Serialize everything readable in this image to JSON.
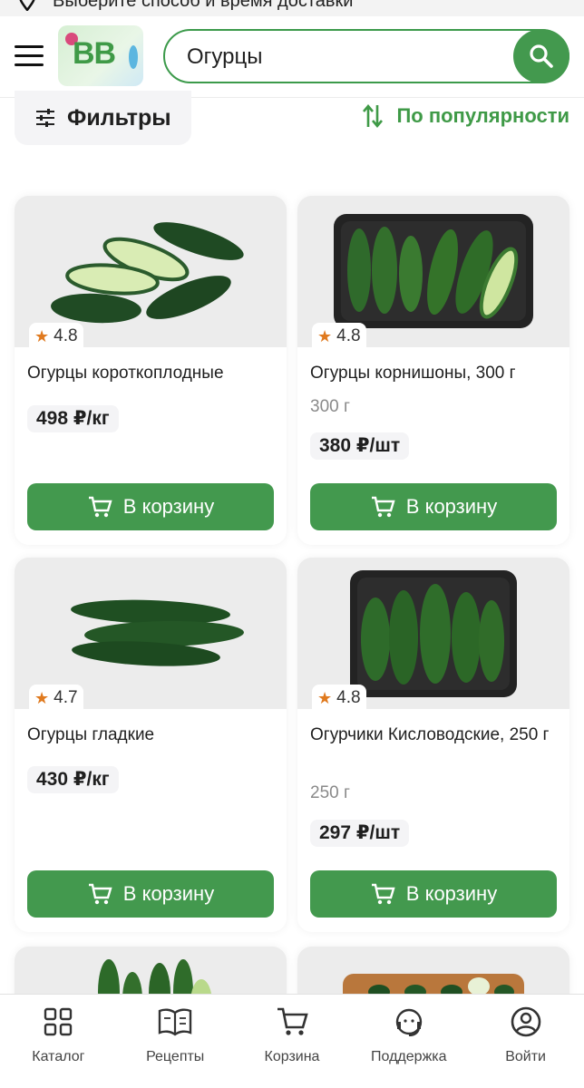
{
  "delivery_bar": {
    "text": "Выберите способ и время доставки"
  },
  "header": {
    "logo_text": "BB",
    "search_value": "Огурцы"
  },
  "filters": {
    "label": "Фильтры"
  },
  "sort": {
    "label": "По популярности"
  },
  "products": [
    {
      "name": "Огурцы короткоплодные",
      "weight": "",
      "rating": "4.8",
      "price": "498 ₽/кг",
      "button": "В корзину"
    },
    {
      "name": "Огурцы корнишоны, 300 г",
      "weight": "300 г",
      "rating": "4.8",
      "price": "380 ₽/шт",
      "button": "В корзину"
    },
    {
      "name": "Огурцы гладкие",
      "weight": "",
      "rating": "4.7",
      "price": "430 ₽/кг",
      "button": "В корзину"
    },
    {
      "name": "Огурчики Кисловодские, 250 г",
      "weight": "250 г",
      "rating": "4.8",
      "price": "297 ₽/шт",
      "button": "В корзину"
    }
  ],
  "bottom_nav": {
    "items": [
      {
        "label": "Каталог",
        "icon": "grid-icon"
      },
      {
        "label": "Рецепты",
        "icon": "book-icon"
      },
      {
        "label": "Корзина",
        "icon": "cart-icon"
      },
      {
        "label": "Поддержка",
        "icon": "support-icon"
      },
      {
        "label": "Войти",
        "icon": "user-icon"
      }
    ]
  },
  "colors": {
    "accent": "#43994e",
    "accent_text": "#3f9a47",
    "star": "#e07a1f"
  }
}
